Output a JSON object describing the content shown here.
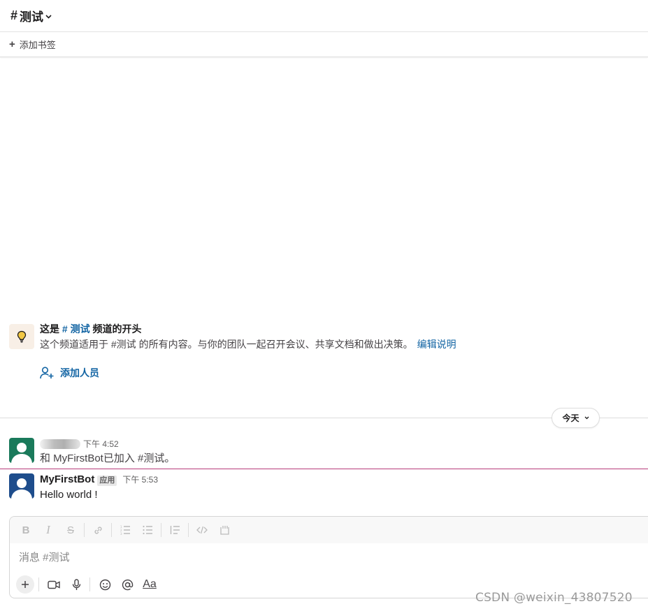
{
  "header": {
    "hash": "#",
    "channel_name": "测试"
  },
  "bookmarks": {
    "add_label": "添加书签"
  },
  "intro": {
    "title_prefix": "这是 ",
    "title_link": "# 测试",
    "title_suffix": " 频道的开头",
    "description": "这个频道适用于 #测试 的所有内容。与你的团队一起召开会议、共享文档和做出决策。",
    "edit_link": "编辑说明",
    "add_people": "添加人员"
  },
  "date_divider": {
    "label": "今天"
  },
  "messages": [
    {
      "time": "下午 4:52",
      "text": "和 MyFirstBot已加入 #测试。"
    },
    {
      "name": "MyFirstBot",
      "badge": "应用",
      "time": "下午 5:53",
      "text": "Hello world !"
    }
  ],
  "composer": {
    "placeholder": "消息 #测试"
  },
  "watermark": "CSDN @weixin_43807520",
  "colors": {
    "link": "#1264a3",
    "new_message_line": "#b83a7a",
    "avatar_green": "#1a7a5b",
    "avatar_blue": "#1e4d8c"
  }
}
